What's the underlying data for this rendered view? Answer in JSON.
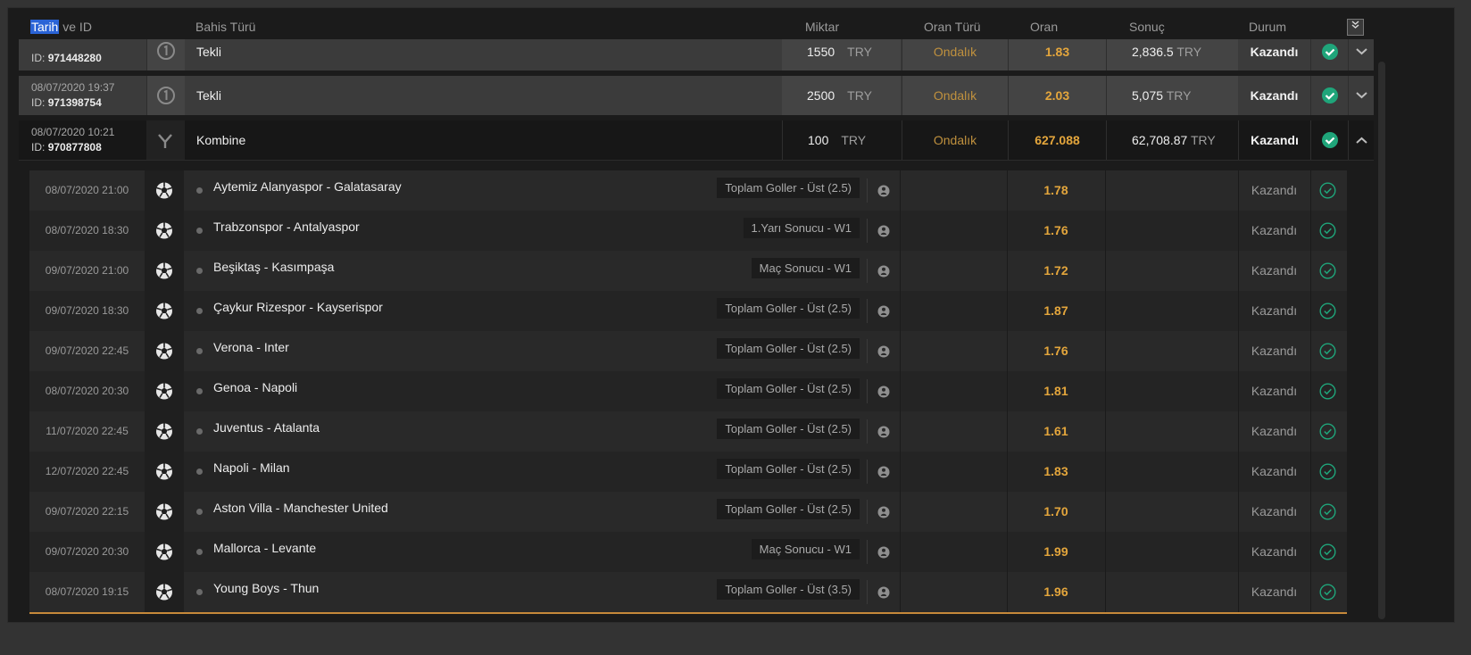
{
  "header": {
    "col_date_sel": "Tarih",
    "col_date_rest": " ve ID",
    "col_type": "Bahis Türü",
    "col_amount": "Miktar",
    "col_odds_type": "Oran Türü",
    "col_odds": "Oran",
    "col_result": "Sonuç",
    "col_status": "Durum",
    "collapse_all_icon": "double-chevron-down-icon"
  },
  "bets": [
    {
      "date": "",
      "id_label": "ID:",
      "id": "971448280",
      "type": "Tekli",
      "amount": "1550",
      "currency": "TRY",
      "odds_type": "Ondalık",
      "odds": "1.83",
      "result": "2,836.5",
      "result_currency": "TRY",
      "status": "Kazandı",
      "icon": "single-bet-icon"
    },
    {
      "date": "08/07/2020 19:37",
      "id_label": "ID:",
      "id": "971398754",
      "type": "Tekli",
      "amount": "2500",
      "currency": "TRY",
      "odds_type": "Ondalık",
      "odds": "2.03",
      "result": "5,075",
      "result_currency": "TRY",
      "status": "Kazandı",
      "icon": "single-bet-icon"
    },
    {
      "date": "08/07/2020 10:21",
      "id_label": "ID:",
      "id": "970877808",
      "type": "Kombine",
      "amount": "100",
      "currency": "TRY",
      "odds_type": "Ondalık",
      "odds": "627.088",
      "result": "62,708.87",
      "result_currency": "TRY",
      "status": "Kazandı",
      "icon": "combo-bet-icon"
    }
  ],
  "legs": [
    {
      "date": "08/07/2020 21:00",
      "match": "Aytemiz Alanyaspor - Galatasaray",
      "market": "Toplam Goller - Üst (2.5)",
      "odds": "1.78",
      "status": "Kazandı"
    },
    {
      "date": "08/07/2020 18:30",
      "match": "Trabzonspor - Antalyaspor",
      "market": "1.Yarı Sonucu - W1",
      "odds": "1.76",
      "status": "Kazandı"
    },
    {
      "date": "09/07/2020 21:00",
      "match": "Beşiktaş - Kasımpaşa",
      "market": "Maç Sonucu - W1",
      "odds": "1.72",
      "status": "Kazandı"
    },
    {
      "date": "09/07/2020 18:30",
      "match": "Çaykur Rizespor - Kayserispor",
      "market": "Toplam Goller - Üst (2.5)",
      "odds": "1.87",
      "status": "Kazandı"
    },
    {
      "date": "09/07/2020 22:45",
      "match": "Verona - Inter",
      "market": "Toplam Goller - Üst (2.5)",
      "odds": "1.76",
      "status": "Kazandı"
    },
    {
      "date": "08/07/2020 20:30",
      "match": "Genoa - Napoli",
      "market": "Toplam Goller - Üst (2.5)",
      "odds": "1.81",
      "status": "Kazandı"
    },
    {
      "date": "11/07/2020 22:45",
      "match": "Juventus - Atalanta",
      "market": "Toplam Goller - Üst (2.5)",
      "odds": "1.61",
      "status": "Kazandı"
    },
    {
      "date": "12/07/2020 22:45",
      "match": "Napoli - Milan",
      "market": "Toplam Goller - Üst (2.5)",
      "odds": "1.83",
      "status": "Kazandı"
    },
    {
      "date": "09/07/2020 22:15",
      "match": "Aston Villa - Manchester United",
      "market": "Toplam Goller - Üst (2.5)",
      "odds": "1.70",
      "status": "Kazandı"
    },
    {
      "date": "09/07/2020 20:30",
      "match": "Mallorca - Levante",
      "market": "Maç Sonucu - W1",
      "odds": "1.99",
      "status": "Kazandı"
    },
    {
      "date": "08/07/2020 19:15",
      "match": "Young Boys - Thun",
      "market": "Toplam Goller - Üst (3.5)",
      "odds": "1.96",
      "status": "Kazandı"
    }
  ],
  "colors": {
    "accent_orange": "#e4a63c",
    "won_green": "#1fa57a",
    "panel_bg": "#1b1b1b"
  }
}
